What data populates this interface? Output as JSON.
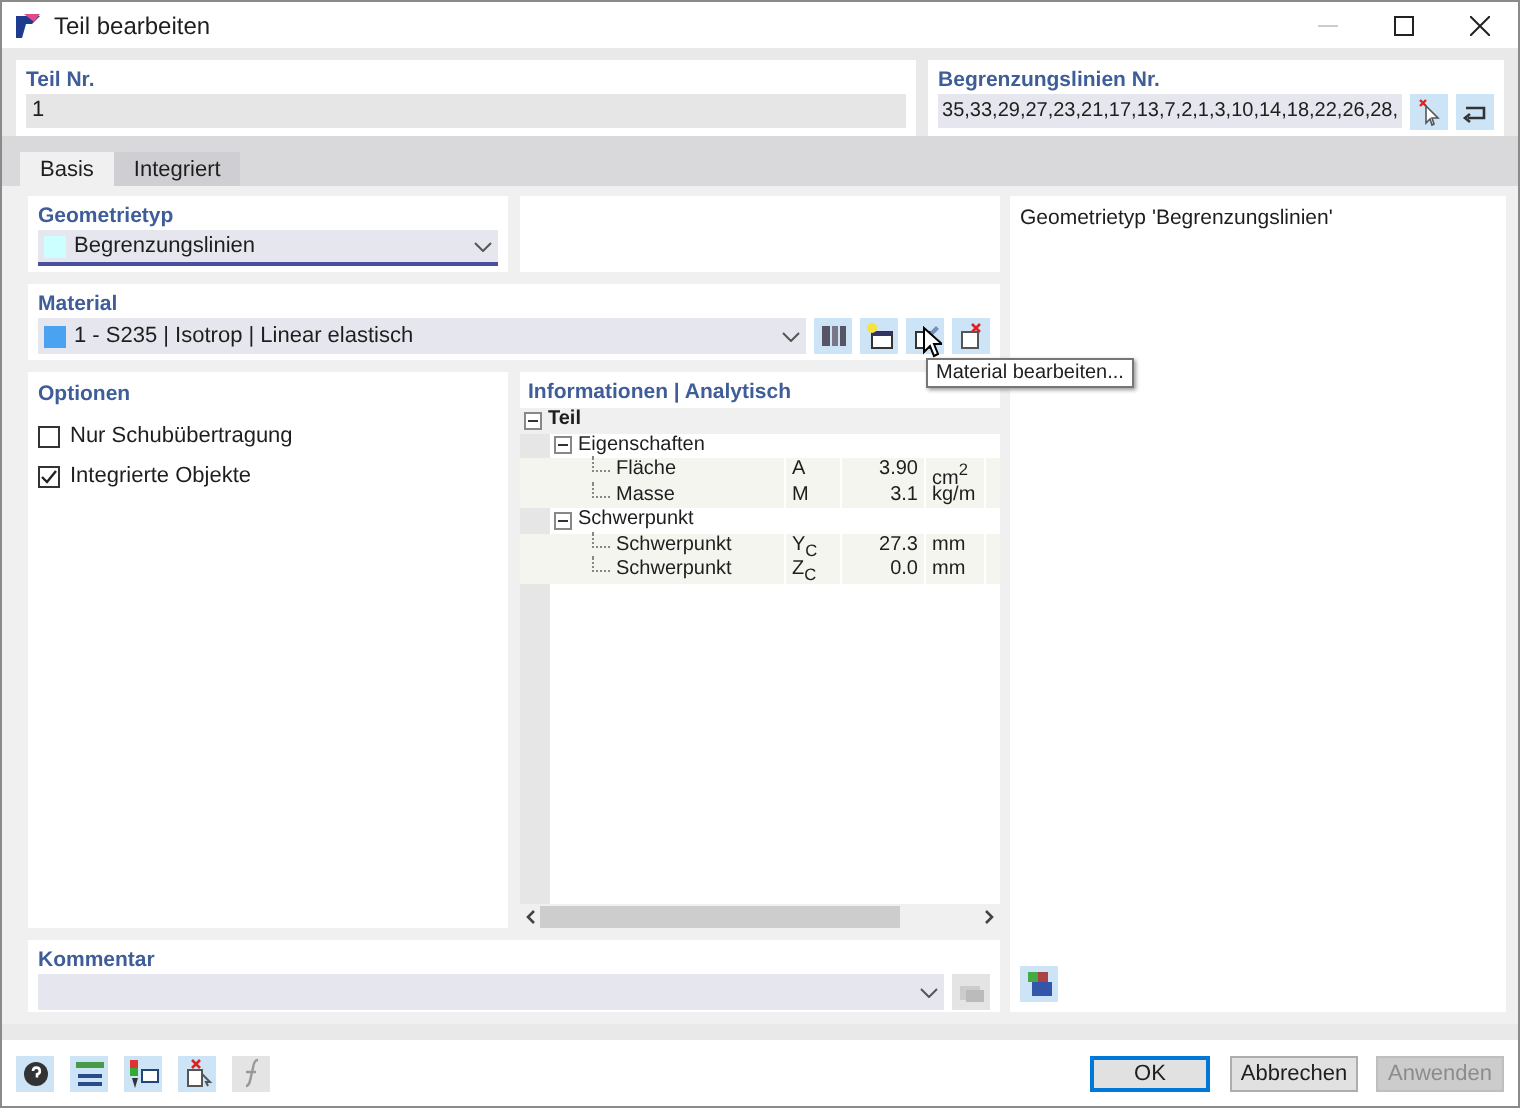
{
  "window": {
    "title": "Teil bearbeiten"
  },
  "part_no": {
    "label": "Teil Nr.",
    "value": "1"
  },
  "boundary_lines": {
    "label": "Begrenzungslinien Nr.",
    "value": "35,33,29,27,23,21,17,13,7,2,1,3,10,14,18,22,26,28,"
  },
  "tabs": [
    {
      "label": "Basis",
      "selected": true
    },
    {
      "label": "Integriert",
      "selected": false
    }
  ],
  "geometry_type": {
    "label": "Geometrietyp",
    "value": "Begrenzungslinien"
  },
  "material": {
    "label": "Material",
    "value": "1 - S235 | Isotrop | Linear elastisch",
    "tooltip": "Material bearbeiten..."
  },
  "options": {
    "title": "Optionen",
    "items": [
      {
        "label": "Nur Schubübertragung",
        "checked": false
      },
      {
        "label": "Integrierte Objekte",
        "checked": true
      }
    ]
  },
  "info": {
    "title": "Informationen | Analytisch",
    "tree": [
      {
        "label": "Teil",
        "expanded": true,
        "children": [
          {
            "label": "Eigenschaften",
            "expanded": true,
            "children": [
              {
                "label": "Fläche",
                "symbol": "A",
                "value": "3.90",
                "unit": "cm$^{2}$"
              },
              {
                "label": "Masse",
                "symbol": "M",
                "value": "3.1",
                "unit": "kg/m"
              }
            ]
          },
          {
            "label": "Schwerpunkt",
            "expanded": true,
            "children": [
              {
                "label": "Schwerpunkt",
                "symbol": "Y$_{C}$",
                "value": "27.3",
                "unit": "mm"
              },
              {
                "label": "Schwerpunkt",
                "symbol": "Z$_{C}$",
                "value": "0.0",
                "unit": "mm"
              }
            ]
          }
        ]
      }
    ]
  },
  "description": "Geometrietyp 'Begrenzungslinien'",
  "comment": {
    "label": "Kommentar"
  },
  "buttons": [
    {
      "label": "OK",
      "default": true,
      "disabled": false
    },
    {
      "label": "Abbrechen",
      "default": false,
      "disabled": false
    },
    {
      "label": "Anwenden",
      "default": false,
      "disabled": true
    }
  ]
}
